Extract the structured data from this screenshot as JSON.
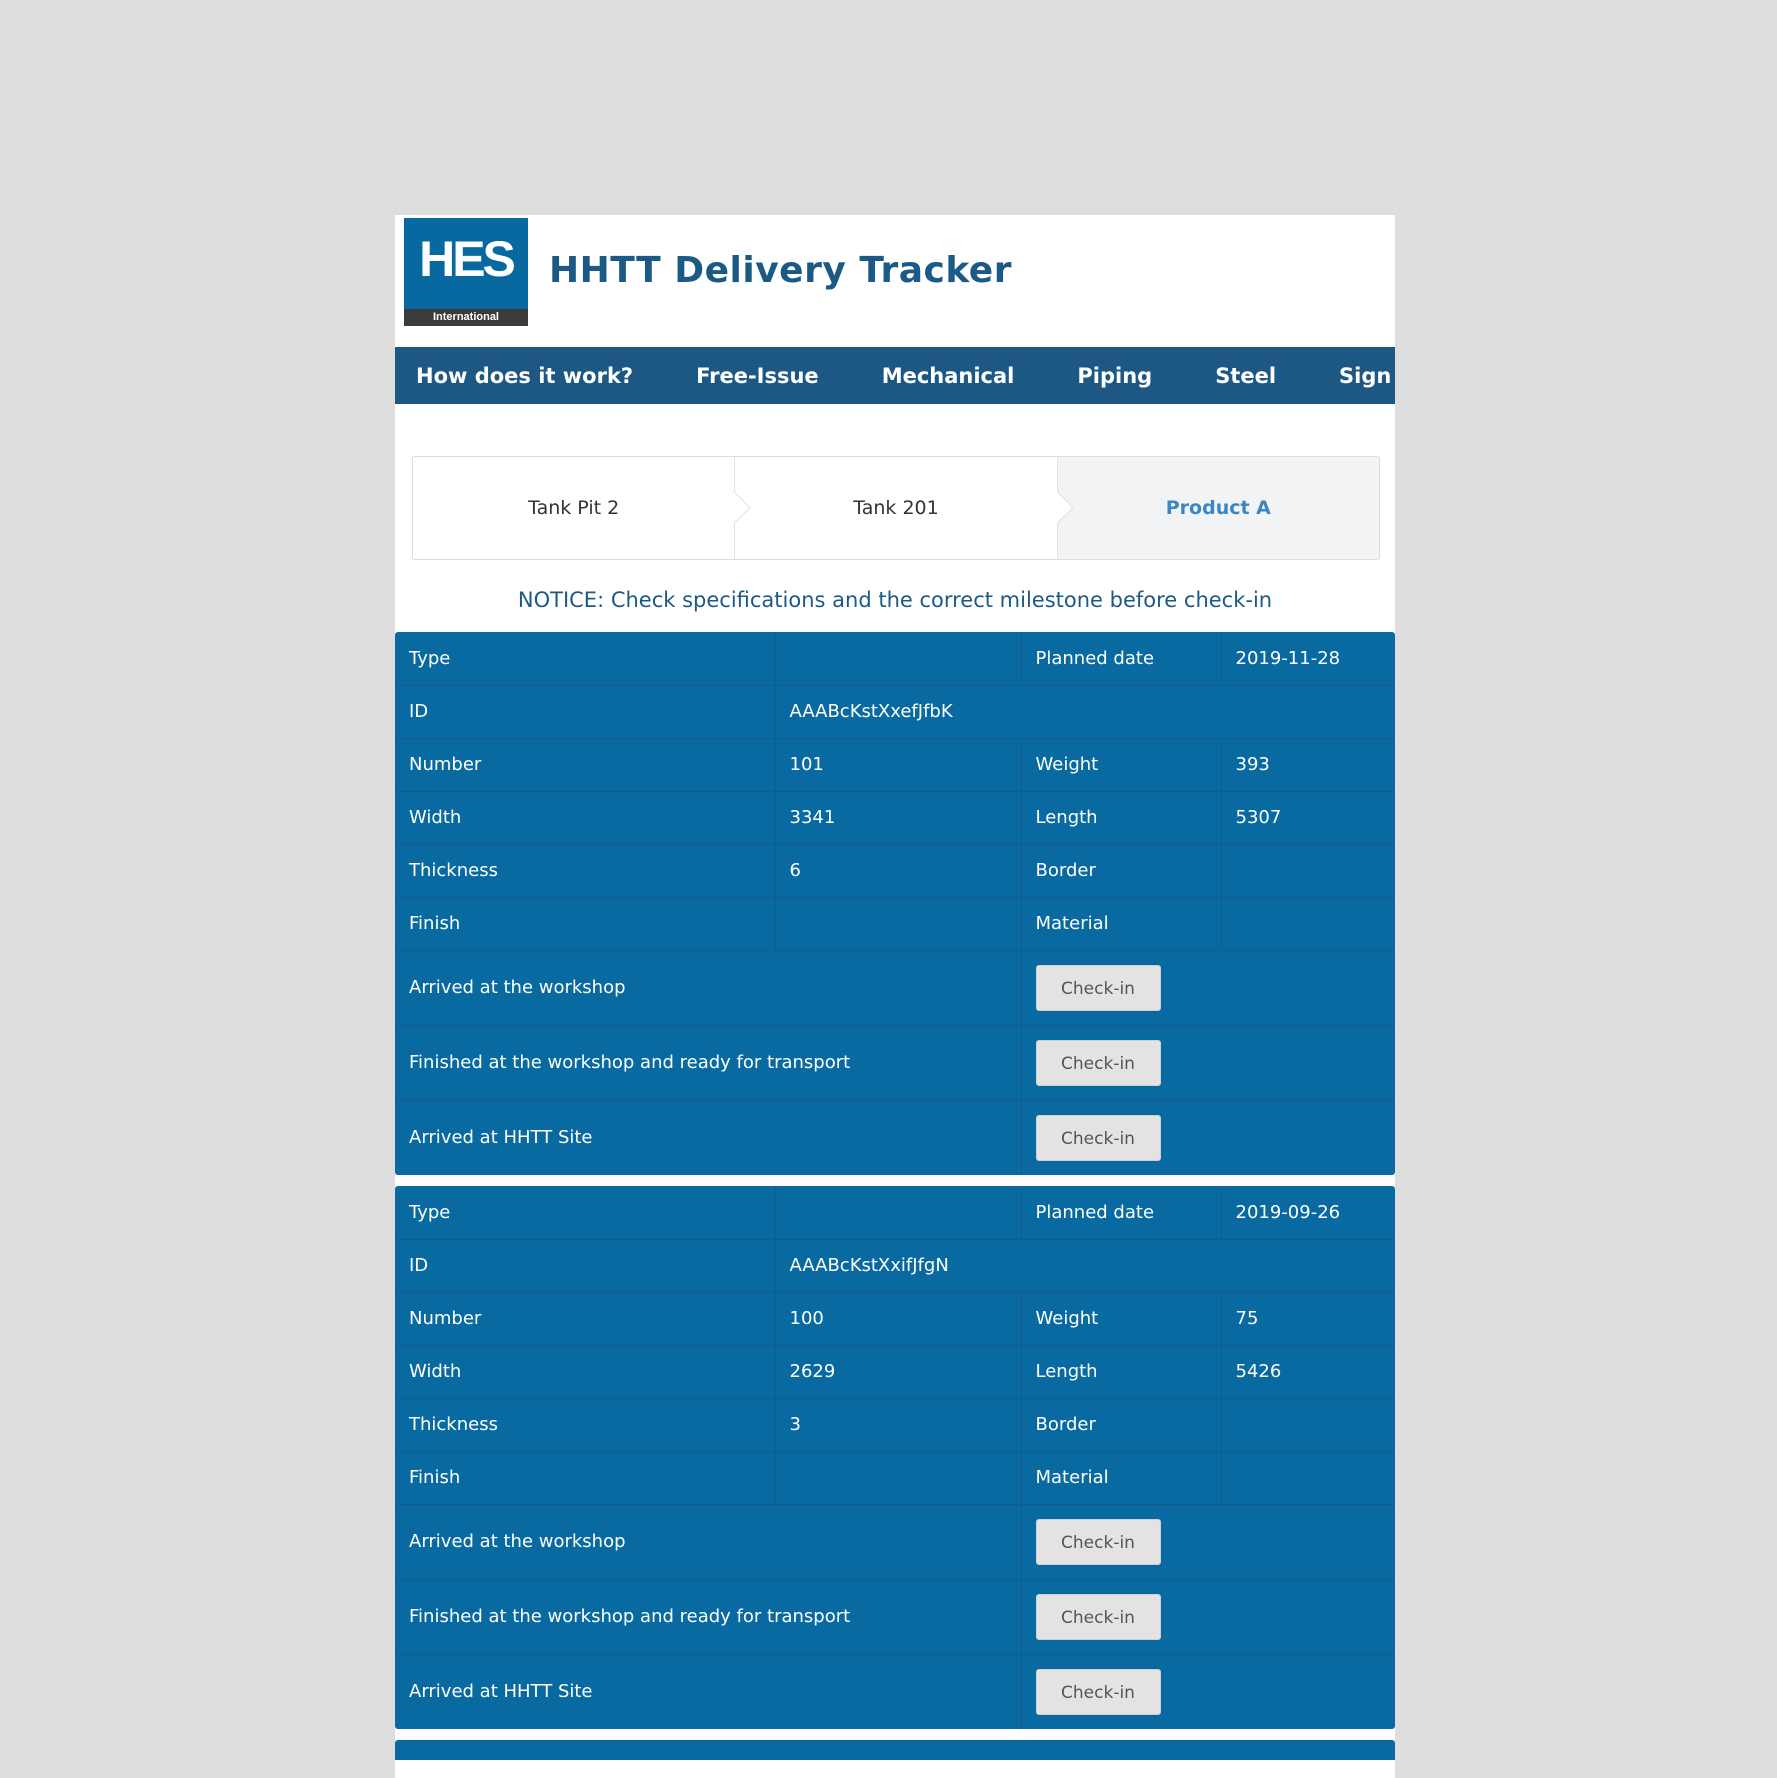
{
  "header": {
    "logo_main": "HES",
    "logo_sub": "International",
    "title": "HHTT Delivery Tracker"
  },
  "nav": [
    {
      "label": "How does it work?"
    },
    {
      "label": "Free-Issue"
    },
    {
      "label": "Mechanical"
    },
    {
      "label": "Piping"
    },
    {
      "label": "Steel"
    },
    {
      "label": "Sign Out"
    }
  ],
  "breadcrumb": [
    {
      "label": "Tank Pit 2"
    },
    {
      "label": "Tank 201"
    },
    {
      "label": "Product A"
    }
  ],
  "notice": "NOTICE: Check specifications and the correct milestone before check-in",
  "labels": {
    "type": "Type",
    "planned_date": "Planned date",
    "id": "ID",
    "number": "Number",
    "weight": "Weight",
    "width": "Width",
    "length": "Length",
    "thickness": "Thickness",
    "border": "Border",
    "finish": "Finish",
    "material": "Material",
    "milestone_1": "Arrived at the workshop",
    "milestone_2": "Finished at the workshop and ready for transport",
    "milestone_3": "Arrived at HHTT Site",
    "checkin": "Check-in"
  },
  "records": [
    {
      "type": "",
      "planned_date": "2019-11-28",
      "id": "AAABcKstXxefJfbK",
      "number": "101",
      "weight": "393",
      "width": "3341",
      "length": "5307",
      "thickness": "6",
      "border": "",
      "finish": "",
      "material": ""
    },
    {
      "type": "",
      "planned_date": "2019-09-26",
      "id": "AAABcKstXxifJfgN",
      "number": "100",
      "weight": "75",
      "width": "2629",
      "length": "5426",
      "thickness": "3",
      "border": "",
      "finish": "",
      "material": ""
    }
  ]
}
